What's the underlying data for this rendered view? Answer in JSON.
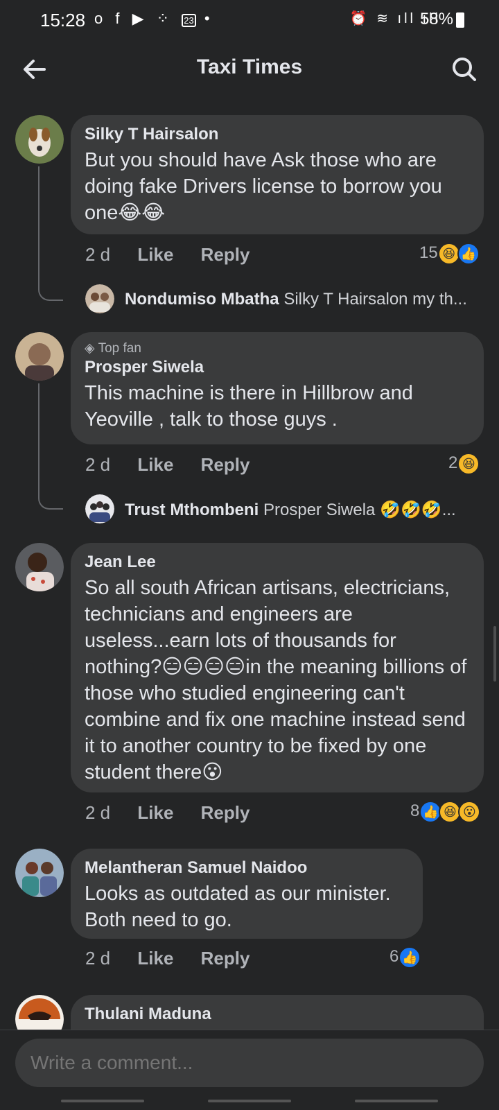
{
  "status": {
    "time": "15:28",
    "battery": "58%",
    "icons_left": [
      "o",
      "f",
      "▶",
      "⁘",
      "23",
      "•"
    ],
    "icons_right": "⏰ ≋ ıll ıll"
  },
  "header": {
    "title": "Taxi Times"
  },
  "comments": [
    {
      "name": "Silky T Hairsalon",
      "text": "But you should have Ask those who are doing fake Drivers license to borrow you one😂😂",
      "time": "2 d",
      "like": "Like",
      "reply": "Reply",
      "reaction_count": "15",
      "reactions": [
        "haha",
        "like"
      ],
      "avatar_color": "#6b7d4a",
      "reply_preview": {
        "name": "Nondumiso Mbatha",
        "text": "Silky T Hairsalon my th...",
        "avatar_color": "#c9b8a6"
      }
    },
    {
      "badge": "Top fan",
      "name": "Prosper Siwela",
      "text": "This machine is there in Hillbrow and Yeoville , talk to those guys .",
      "time": "2 d",
      "like": "Like",
      "reply": "Reply",
      "reaction_count": "2",
      "reactions": [
        "haha"
      ],
      "avatar_color": "#8a7664",
      "reply_preview": {
        "name": "Trust Mthombeni",
        "text": "Prosper Siwela 🤣🤣🤣...",
        "avatar_color": "#5a6680"
      }
    },
    {
      "name": "Jean Lee",
      "text": "So all south African artisans, electricians, technicians and engineers are useless...earn lots of thousands for nothing?😑😑😑😑in the meaning billions of those who studied engineering can't combine and fix one machine instead send it to another country to be fixed by one student there😮",
      "time": "2 d",
      "like": "Like",
      "reply": "Reply",
      "reaction_count": "8",
      "reactions": [
        "like",
        "haha",
        "wow"
      ],
      "avatar_color": "#7a4a3a"
    },
    {
      "name": "Melantheran Samuel Naidoo",
      "text": "Looks as outdated as our minister. Both need to go.",
      "time": "2 d",
      "like": "Like",
      "reply": "Reply",
      "reaction_count": "6",
      "reactions": [
        "like"
      ],
      "avatar_color": "#6a8aa0"
    },
    {
      "name": "Thulani Maduna",
      "avatar_color": "#c85a1e"
    }
  ],
  "composer": {
    "placeholder": "Write a comment..."
  }
}
